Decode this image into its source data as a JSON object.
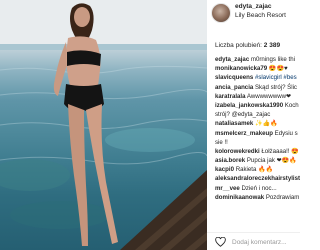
{
  "post": {
    "username": "edyta_zajac",
    "location": "Lily Beach Resort",
    "likes_label": "Liczba polubień:",
    "likes_count": "2 389"
  },
  "comments": [
    {
      "user": "edyta_zajac",
      "text": "m0rnings like thi"
    },
    {
      "user": "monikanowicka79",
      "text": "😍😍♥"
    },
    {
      "user": "slavicqueens",
      "text": "#slavicgirl #bes",
      "tag": true
    },
    {
      "user": "ancia_pancia",
      "text": "Skąd strój? Ślic"
    },
    {
      "user": "karatralala",
      "text": "Awwwwwwww❤"
    },
    {
      "user": "izabela_jankowska1990",
      "text": "Koch"
    },
    {
      "user": "",
      "text": "strój? @edyta_zajac"
    },
    {
      "user": "nataliasamek",
      "text": "✨👍🔥"
    },
    {
      "user": "msmelcerz_makeup",
      "text": "Edysiu s"
    },
    {
      "user": "",
      "text": "sie !!"
    },
    {
      "user": "kolorowekredki",
      "text": "Łołżaaaa!! 😍"
    },
    {
      "user": "asia.borek",
      "text": "Pupcia jak ❤😍🔥"
    },
    {
      "user": "kacpi0",
      "text": "Rakieta 🔥🔥"
    },
    {
      "user": "aleksandraloreczekhairstylist",
      "text": ""
    },
    {
      "user": "mr__vee",
      "text": "Dzień i noc..."
    },
    {
      "user": "dominikaanowak",
      "text": "Pozdrawiam"
    }
  ],
  "footer": {
    "comment_placeholder": "Dodaj komentarz..."
  },
  "colors": {
    "text": "#262626",
    "hashtag": "#003569",
    "placeholder": "#999999",
    "divider": "#efefef"
  },
  "icons": {
    "like": "heart-outline-icon"
  }
}
